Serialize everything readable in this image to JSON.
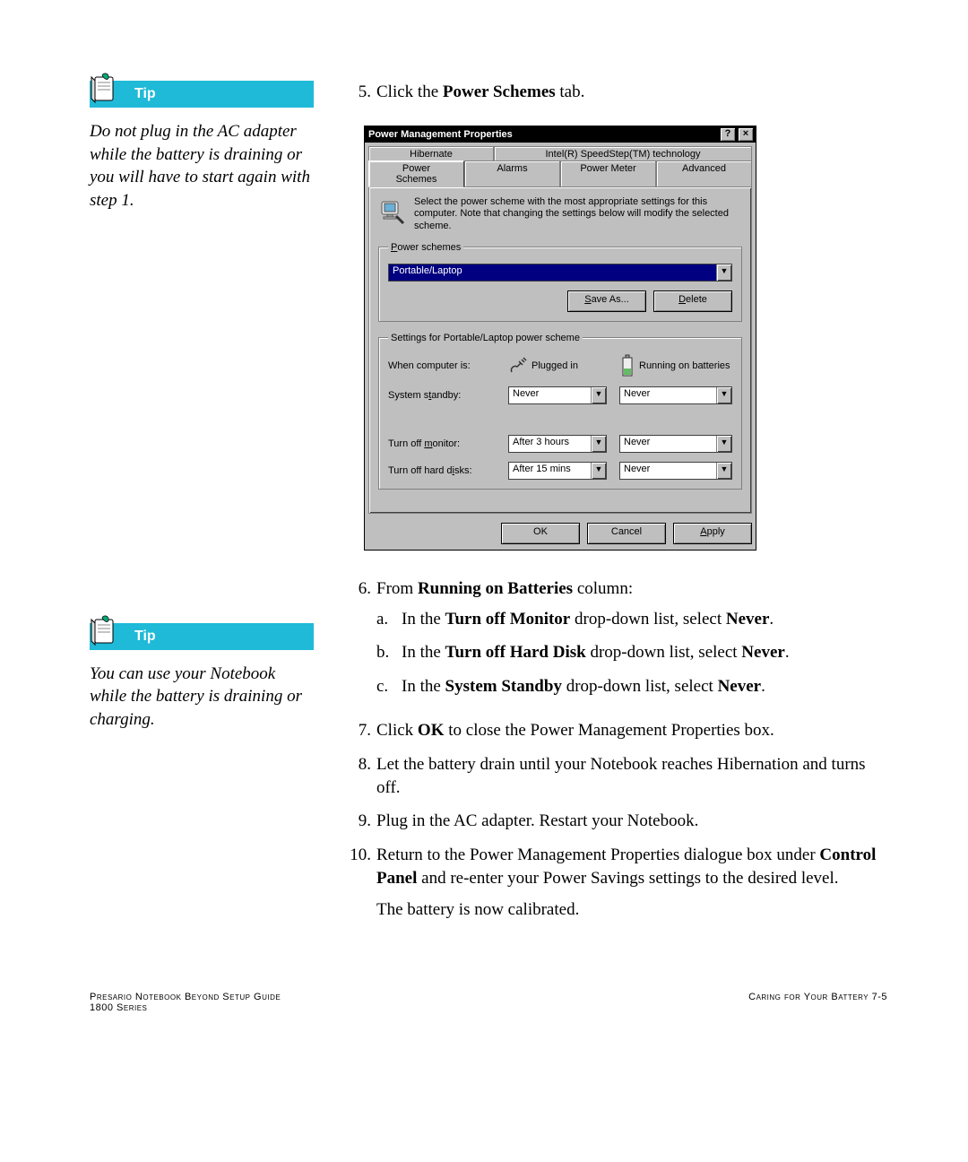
{
  "sidebar": {
    "tip1_label": "Tip",
    "tip1_body": "Do not plug in the AC adapter while the battery is draining or you will have to start again with step 1.",
    "tip2_label": "Tip",
    "tip2_body": "You can use your Notebook while the battery is draining or charging."
  },
  "steps": {
    "s5_num": "5.",
    "s5_a": "Click the ",
    "s5_b": "Power Schemes",
    "s5_c": " tab.",
    "s6_num": "6.",
    "s6_a": "From ",
    "s6_b": "Running on Batteries",
    "s6_c": " column:",
    "s6a_num": "a.",
    "s6a_a": "In the ",
    "s6a_b": "Turn off Monitor",
    "s6a_c": " drop-down list, select ",
    "s6a_d": "Never",
    "s6a_e": ".",
    "s6b_num": "b.",
    "s6b_a": "In the ",
    "s6b_b": "Turn off Hard Disk",
    "s6b_c": " drop-down list, select ",
    "s6b_d": "Never",
    "s6b_e": ".",
    "s6c_num": "c.",
    "s6c_a": "In the ",
    "s6c_b": "System Standby",
    "s6c_c": " drop-down list, select ",
    "s6c_d": "Never",
    "s6c_e": ".",
    "s7_num": "7.",
    "s7_a": "Click ",
    "s7_b": "OK",
    "s7_c": " to close the Power Management Properties box.",
    "s8_num": "8.",
    "s8_text": "Let the battery drain until your Notebook reaches Hibernation and turns off.",
    "s9_num": "9.",
    "s9_text": "Plug in the AC adapter. Restart your Notebook.",
    "s10_num": "10.",
    "s10_a": "Return to the Power Management Properties dialogue box under ",
    "s10_b": "Control Panel",
    "s10_c": " and re-enter your Power Savings settings to the desired level.",
    "closing": "The battery is now calibrated."
  },
  "dialog": {
    "title": "Power Management Properties",
    "help": "?",
    "close": "×",
    "tabs_back": [
      "Hibernate",
      "Intel(R) SpeedStep(TM) technology"
    ],
    "tabs_front": [
      "Power Schemes",
      "Alarms",
      "Power Meter",
      "Advanced"
    ],
    "info": "Select the power scheme with the most appropriate settings for this computer. Note that changing the settings below will modify the selected scheme.",
    "ps_legend_a": "P",
    "ps_legend_b": "ower schemes",
    "scheme": "Portable/Laptop",
    "save_as_a": "S",
    "save_as_b": "ave As...",
    "delete_a": "D",
    "delete_b": "elete",
    "settings_legend": "Settings for Portable/Laptop power scheme",
    "when": "When computer is:",
    "plugged": "Plugged in",
    "battery": "Running on batteries",
    "standby_a": "System s",
    "standby_u": "t",
    "standby_b": "andby:",
    "standby_plugged": "Never",
    "standby_batt": "Never",
    "monitor_a": "Turn off ",
    "monitor_u": "m",
    "monitor_b": "onitor:",
    "monitor_plugged": "After 3 hours",
    "monitor_batt": "Never",
    "disk_a": "Turn off hard d",
    "disk_u": "i",
    "disk_b": "sks:",
    "disk_plugged": "After 15 mins",
    "disk_batt": "Never",
    "ok": "OK",
    "cancel": "Cancel",
    "apply_u": "A",
    "apply_b": "pply"
  },
  "footer": {
    "left1": "Presario Notebook Beyond Setup Guide",
    "left2": "1800 Series",
    "right": "Caring for Your Battery   7-5"
  }
}
